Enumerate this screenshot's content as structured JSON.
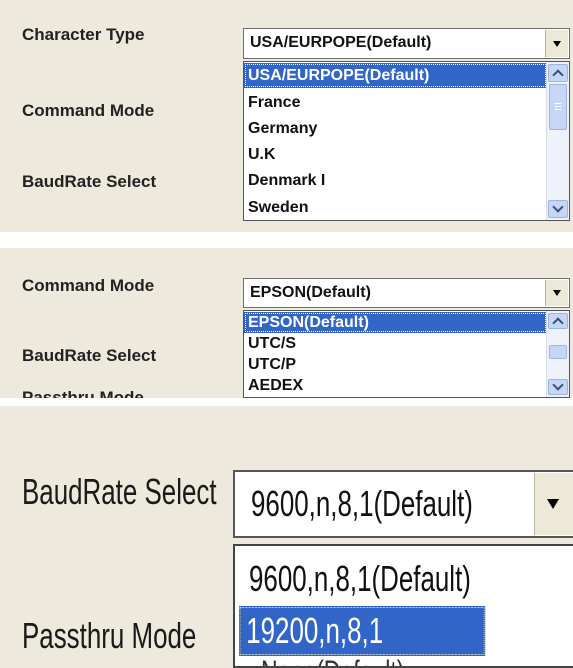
{
  "panel1": {
    "labels": [
      "Character Type",
      "Command Mode",
      "BaudRate Select"
    ],
    "combo_value": "USA/EURPOPE(Default)",
    "options": [
      "USA/EURPOPE(Default)",
      "France",
      "Germany",
      "U.K",
      "Denmark I",
      "Sweden"
    ],
    "selected_index": 0
  },
  "panel2": {
    "labels": [
      "Command Mode",
      "BaudRate Select",
      "Passthru Mode"
    ],
    "combo_value": "EPSON(Default)",
    "options": [
      "EPSON(Default)",
      "UTC/S",
      "UTC/P",
      "AEDEX"
    ],
    "selected_index": 0
  },
  "panel3": {
    "labels": [
      "BaudRate Select",
      "Passthru Mode"
    ],
    "combo_value": "9600,n,8,1(Default)",
    "options": [
      "9600,n,8,1(Default)",
      "19200,n,8,1"
    ],
    "hidden_combo_value": "None(Default)",
    "selected_index": 1
  },
  "colors": {
    "panel_bg": "#ede9dc",
    "highlight": "#3166c8",
    "scroll": "#c6d6f7"
  }
}
